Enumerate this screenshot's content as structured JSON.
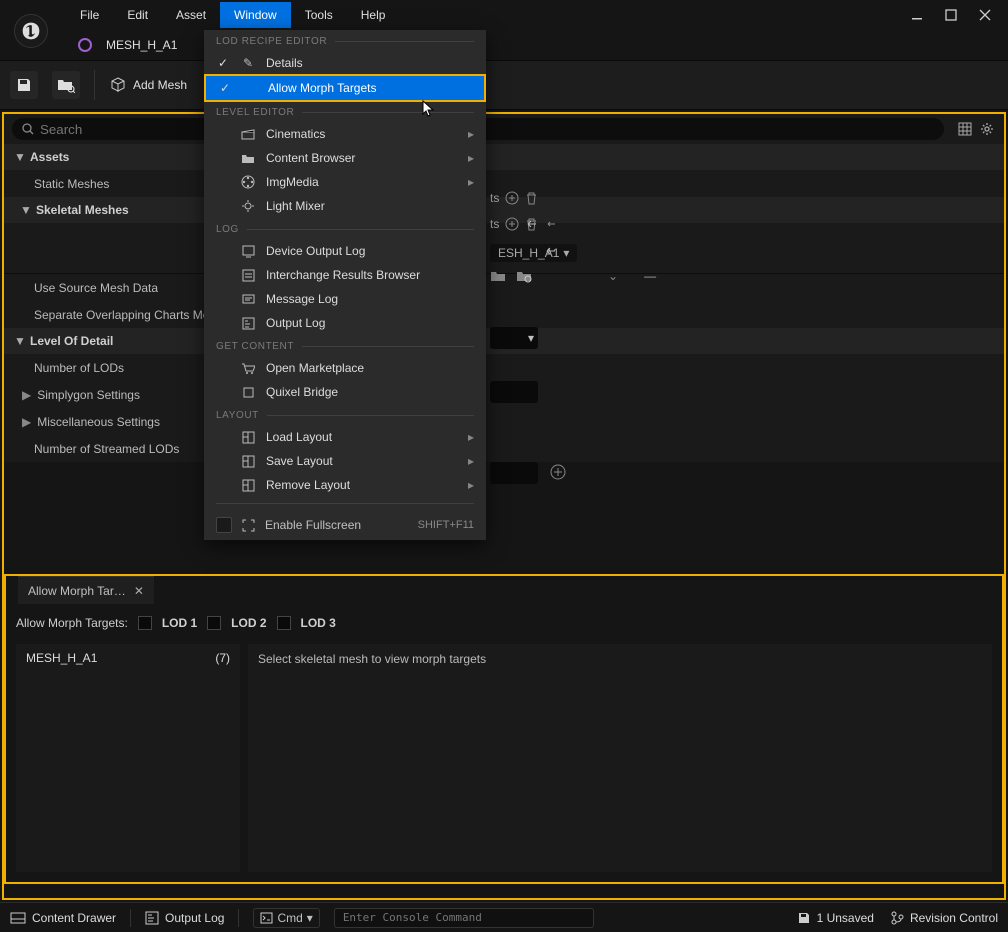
{
  "menubar": {
    "file": "File",
    "edit": "Edit",
    "asset": "Asset",
    "window": "Window",
    "tools": "Tools",
    "help": "Help"
  },
  "asset": {
    "name": "MESH_H_A1"
  },
  "toolbar": {
    "add_mesh": "Add Mesh"
  },
  "search": {
    "placeholder": "Search"
  },
  "tree": {
    "assets": "Assets",
    "static_meshes": "Static Meshes",
    "skeletal_meshes": "Skeletal Meshes",
    "use_source": "Use Source Mesh Data",
    "separate_overlap": "Separate Overlapping Charts Mode",
    "lod_header": "Level Of Detail",
    "num_lods": "Number of LODs",
    "simplygon": "Simplygon Settings",
    "misc": "Miscellaneous  Settings",
    "streamed": "Number of Streamed LODs"
  },
  "dropdown": {
    "sec_lod": "LOD RECIPE EDITOR",
    "details": "Details",
    "allow_morph": "Allow Morph Targets",
    "sec_level": "LEVEL EDITOR",
    "cinematics": "Cinematics",
    "content_browser": "Content Browser",
    "imgmedia": "ImgMedia",
    "light_mixer": "Light Mixer",
    "sec_log": "LOG",
    "device_log": "Device Output Log",
    "interchange": "Interchange Results Browser",
    "message_log": "Message Log",
    "output_log": "Output Log",
    "sec_get": "GET CONTENT",
    "marketplace": "Open Marketplace",
    "quixel": "Quixel Bridge",
    "sec_layout": "LAYOUT",
    "load_layout": "Load Layout",
    "save_layout": "Save Layout",
    "remove_layout": "Remove Layout",
    "fullscreen": "Enable Fullscreen",
    "fullscreen_shortcut": "SHIFT+F11"
  },
  "right": {
    "ts_suffix": "ts",
    "tags_suffix_1": "ts",
    "mesh_pill": "ESH_H_A1"
  },
  "morph": {
    "tab_title": "Allow Morph Tar…",
    "toolbar_label": "Allow Morph Targets:",
    "lod1": "LOD 1",
    "lod2": "LOD 2",
    "lod3": "LOD 3",
    "mesh_name": "MESH_H_A1",
    "mesh_count": "(7)",
    "content_hint": "Select skeletal mesh to view morph targets"
  },
  "status": {
    "content_drawer": "Content Drawer",
    "output_log": "Output Log",
    "cmd": "Cmd",
    "console_placeholder": "Enter Console Command",
    "unsaved": "1 Unsaved",
    "revision": "Revision Control"
  }
}
